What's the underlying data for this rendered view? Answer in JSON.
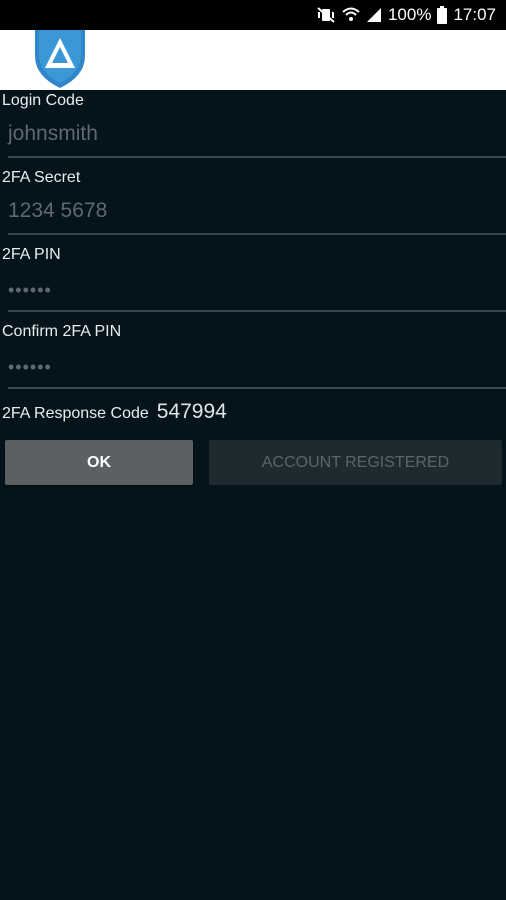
{
  "status_bar": {
    "battery_text": "100%",
    "time": "17:07",
    "icons": [
      "vibrate-mute-icon",
      "wifi-icon",
      "signal-icon",
      "battery-icon"
    ]
  },
  "header": {
    "logo_icon": "shield-logo-icon",
    "brand_color": "#2f86c8"
  },
  "form": {
    "login_code": {
      "label": "Login Code",
      "value": "johnsmith"
    },
    "secret": {
      "label": "2FA Secret",
      "value": "1234 5678"
    },
    "pin": {
      "label": "2FA PIN",
      "value": "••••••"
    },
    "confirm_pin": {
      "label": "Confirm 2FA PIN",
      "value": "••••••"
    },
    "response": {
      "label": "2FA Response Code",
      "value": "547994"
    }
  },
  "buttons": {
    "ok_label": "OK",
    "register_label": "ACCOUNT REGISTERED"
  }
}
